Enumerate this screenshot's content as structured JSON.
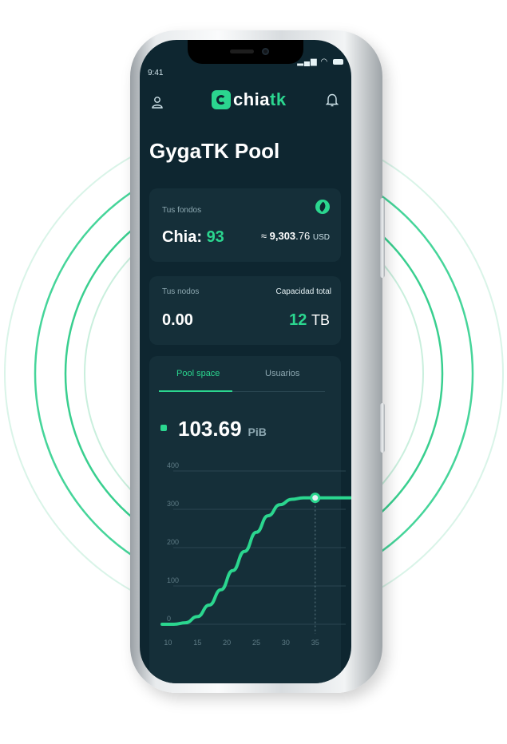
{
  "status_bar": {
    "time": "9:41"
  },
  "header": {
    "logo_prefix": "chia",
    "logo_suffix": "tk"
  },
  "page_title": "GygaTK Pool",
  "funds_card": {
    "label": "Tus fondos",
    "chia_label": "Chia:",
    "chia_value": "93",
    "usd_approx": "≈",
    "usd_int": "9,303",
    "usd_dec": ".76",
    "usd_unit": "USD"
  },
  "nodes_card": {
    "nodes_label": "Tus nodos",
    "nodes_value": "0.00",
    "capacity_label": "Capacidad total",
    "capacity_value": "12",
    "capacity_unit": "TB"
  },
  "tabs": [
    {
      "label": "Pool space",
      "active": true
    },
    {
      "label": "Usuarios",
      "active": false
    }
  ],
  "metric": {
    "value": "103.69",
    "unit": "PiB"
  },
  "colors": {
    "accent": "#2bd68f",
    "background": "#0e2630",
    "card": "#152f39"
  },
  "chart_data": {
    "type": "line",
    "x_ticks": [
      "10",
      "15",
      "20",
      "25",
      "30",
      "35"
    ],
    "y_ticks": [
      "0",
      "100",
      "200",
      "300",
      "400"
    ],
    "xlim": [
      9,
      41
    ],
    "ylim": [
      0,
      400
    ],
    "series": [
      {
        "x": [
          9,
          11,
          13,
          15,
          17,
          19,
          21,
          23,
          25,
          27,
          29,
          31,
          33,
          35,
          37,
          39,
          41
        ],
        "values": [
          0,
          0,
          4,
          20,
          50,
          90,
          140,
          190,
          240,
          283,
          312,
          326,
          330,
          330,
          330,
          330,
          330
        ]
      }
    ],
    "highlight": {
      "x": 35,
      "y": 330
    },
    "grid": true
  }
}
